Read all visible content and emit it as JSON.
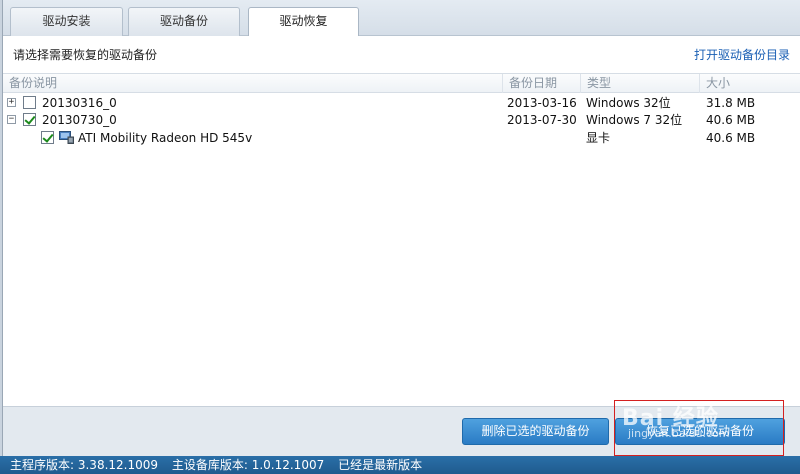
{
  "tabs": [
    {
      "label": "驱动安装",
      "active": false
    },
    {
      "label": "驱动备份",
      "active": false
    },
    {
      "label": "驱动恢复",
      "active": true
    }
  ],
  "panel": {
    "hint": "请选择需要恢复的驱动备份",
    "open_dir_link": "打开驱动备份目录"
  },
  "table": {
    "headers": {
      "name": "备份说明",
      "date": "备份日期",
      "type": "类型",
      "size": "大小"
    },
    "rows": [
      {
        "expander": "+",
        "checked": false,
        "name": "20130316_0",
        "date": "2013-03-16",
        "type": "Windows 32位",
        "size": "31.8 MB"
      },
      {
        "expander": "−",
        "checked": true,
        "name": "20130730_0",
        "date": "2013-07-30",
        "type": "Windows 7 32位",
        "size": "40.6 MB"
      },
      {
        "child": true,
        "checked": true,
        "icon": "display-adapter-icon",
        "name": "ATI Mobility Radeon HD 545v",
        "date": "",
        "type": "显卡",
        "size": "40.6 MB"
      }
    ]
  },
  "actions": {
    "delete_label": "删除已选的驱动备份",
    "restore_label": "恢复已选的驱动备份"
  },
  "watermark": {
    "text": "Bai 经验",
    "url": "jingyan.baidu.com"
  },
  "status": {
    "program_version": "主程序版本: 3.38.12.1009",
    "db_version": "主设备库版本: 1.0.12.1007",
    "state": "已经是最新版本"
  },
  "colors": {
    "accent": "#2a7bc4",
    "status_bar": "#1f5b8e",
    "link": "#1a5fb4",
    "check": "#1c8a1c",
    "highlight": "#d42020"
  }
}
